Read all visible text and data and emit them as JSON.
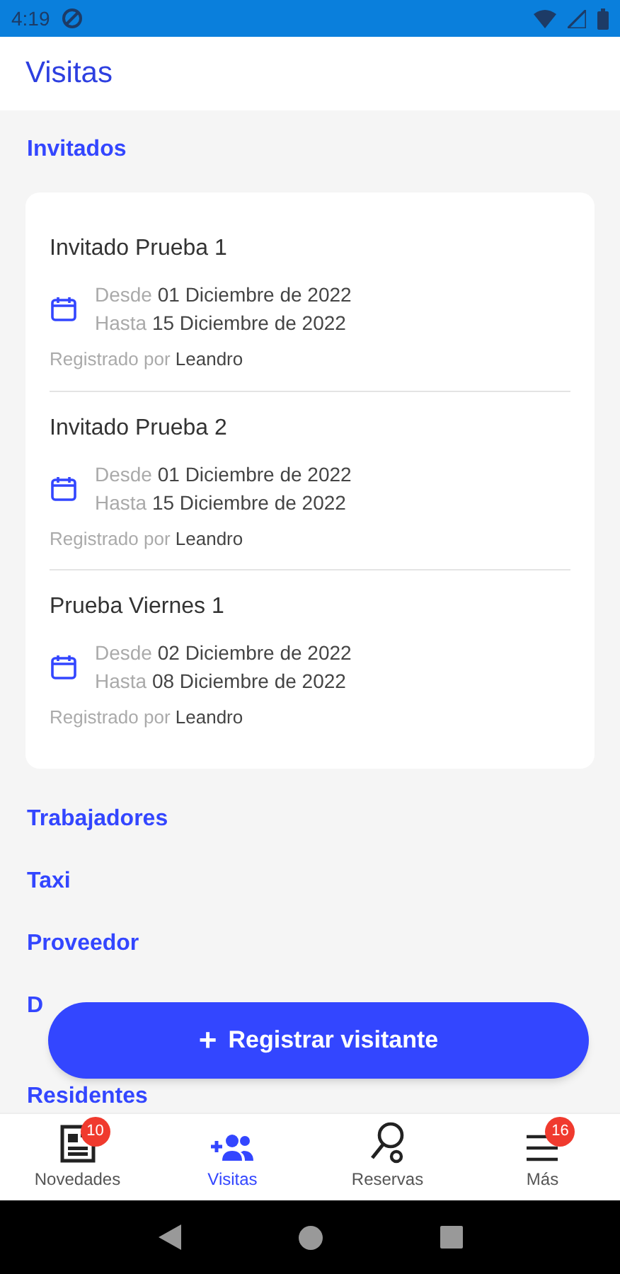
{
  "status_bar": {
    "time": "4:19"
  },
  "header": {
    "title": "Visitas"
  },
  "sections": [
    {
      "title": "Invitados",
      "guests": [
        {
          "name": "Invitado Prueba 1",
          "from_label": "Desde",
          "from": "01 Diciembre de 2022",
          "to_label": "Hasta",
          "to": "15 Diciembre de 2022",
          "registered_label": "Registrado por",
          "registered_by": "Leandro"
        },
        {
          "name": "Invitado Prueba 2",
          "from_label": "Desde",
          "from": "01 Diciembre de 2022",
          "to_label": "Hasta",
          "to": "15 Diciembre de 2022",
          "registered_label": "Registrado por",
          "registered_by": "Leandro"
        },
        {
          "name": "Prueba Viernes 1",
          "from_label": "Desde",
          "from": "02 Diciembre de 2022",
          "to_label": "Hasta",
          "to": "08 Diciembre de 2022",
          "registered_label": "Registrado por",
          "registered_by": "Leandro"
        }
      ]
    },
    {
      "title": "Trabajadores"
    },
    {
      "title": "Taxi"
    },
    {
      "title": "Proveedor"
    },
    {
      "title": "D"
    },
    {
      "title": "Residentes"
    }
  ],
  "fab": {
    "icon": "+",
    "label": "Registrar visitante"
  },
  "bottom_nav": [
    {
      "kind": "news",
      "label": "Novedades",
      "badge": "10",
      "selected": false
    },
    {
      "kind": "visits",
      "label": "Visitas",
      "selected": true
    },
    {
      "kind": "reservations",
      "label": "Reservas",
      "selected": false
    },
    {
      "kind": "more",
      "label": "Más",
      "badge": "16",
      "selected": false
    }
  ]
}
